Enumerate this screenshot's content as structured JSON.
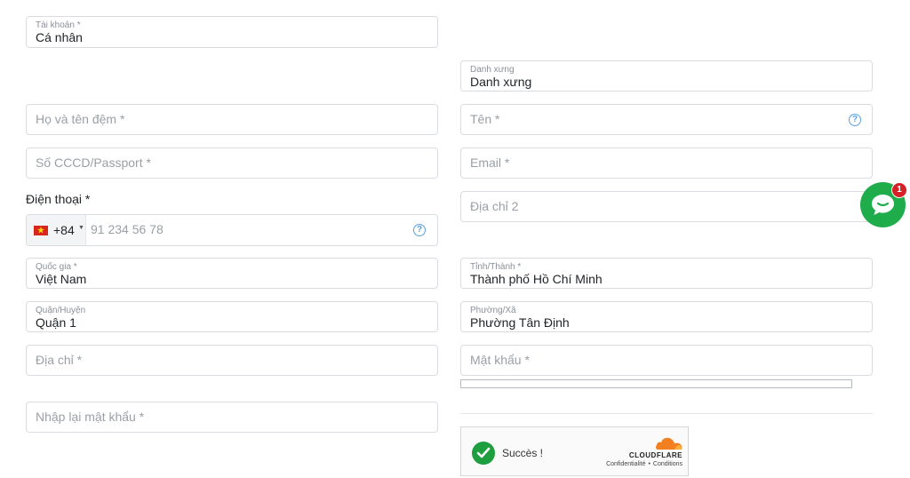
{
  "account": {
    "label": "Tài khoản *",
    "value": "Cá nhân"
  },
  "salutation": {
    "label": "Danh xưng",
    "value": "Danh xưng"
  },
  "last_middle_name": {
    "placeholder": "Họ và tên đệm *"
  },
  "first_name": {
    "placeholder": "Tên *",
    "help_icon": "?"
  },
  "id_number": {
    "placeholder": "Số CCCD/Passport *"
  },
  "email": {
    "placeholder": "Email *"
  },
  "phone": {
    "label": "Điện thoại *",
    "country_code": "+84",
    "placeholder": "91 234 56 78",
    "help_icon": "?"
  },
  "address2": {
    "placeholder": "Địa chỉ 2"
  },
  "country": {
    "label": "Quốc gia *",
    "value": "Việt Nam"
  },
  "province": {
    "label": "Tỉnh/Thành *",
    "value": "Thành phố Hồ Chí Minh"
  },
  "district": {
    "label": "Quận/Huyện",
    "value": "Quận 1"
  },
  "ward": {
    "label": "Phường/Xã",
    "value": "Phường Tân Định"
  },
  "address": {
    "placeholder": "Địa chỉ *"
  },
  "password": {
    "placeholder": "Mật khẩu *"
  },
  "confirm_password": {
    "placeholder": "Nhập lại mật khẩu *"
  },
  "captcha": {
    "status": "Succès !",
    "brand": "CLOUDFLARE",
    "privacy": "Confidentialité",
    "separator": "•",
    "conditions": "Conditions"
  },
  "chat": {
    "badge_count": "1"
  },
  "colors": {
    "success": "#1e9e3e",
    "chat": "#1fad4b",
    "badge": "#d71f26",
    "cloudflare": "#f38020"
  }
}
